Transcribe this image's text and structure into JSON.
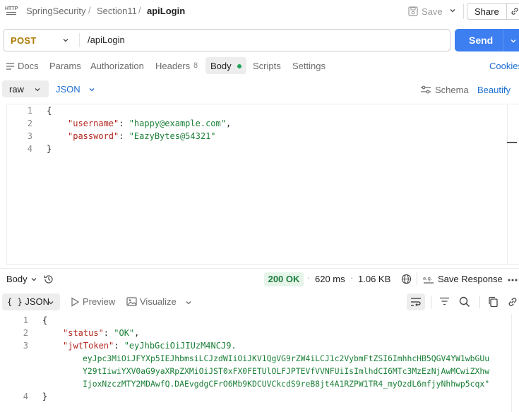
{
  "header": {
    "app_icon_text": "HTTP",
    "breadcrumbs": [
      "SpringSecurity",
      "Section11"
    ],
    "request_name": "apiLogin",
    "save_label": "Save",
    "share_label": "Share"
  },
  "request": {
    "method": "POST",
    "url": "/apiLogin",
    "send_label": "Send",
    "method_color": "#ad7a03",
    "send_color": "#3d7ff0"
  },
  "request_tabs": {
    "docs": "Docs",
    "params": "Params",
    "authorization": "Authorization",
    "headers": "Headers",
    "headers_count": "8",
    "body": "Body",
    "scripts": "Scripts",
    "settings": "Settings",
    "cookies": "Cookies"
  },
  "body_options": {
    "mode": "raw",
    "language": "JSON",
    "schema": "Schema",
    "beautify": "Beautify"
  },
  "request_body": {
    "line_numbers": [
      "1",
      "2",
      "3",
      "4"
    ],
    "open_brace": "{",
    "username_key": "\"username\"",
    "username_value": "\"happy@example.com\"",
    "password_key": "\"password\"",
    "password_value": "\"EazyBytes@54321\"",
    "close_brace": "}"
  },
  "response_bar": {
    "body_label": "Body",
    "status": "200 OK",
    "time": "620 ms",
    "size": "1.06 KB",
    "save_response": "Save Response",
    "status_color": "#1e7d3e"
  },
  "response_view": {
    "format": "JSON",
    "preview": "Preview",
    "visualize": "Visualize"
  },
  "response_body": {
    "line_numbers": [
      "1",
      "2",
      "3",
      "4"
    ],
    "open_brace": "{",
    "status_key": "\"status\"",
    "status_value": "\"OK\"",
    "token_key": "\"jwtToken\"",
    "token_lines": [
      "\"eyJhbGciOiJIUzM4NCJ9.",
      "eyJpc3MiOiJFYXp5IEJhbmsiLCJzdWIiOiJKV1QgVG9rZW4iLCJ1c2VybmFtZSI6ImhhcHB5QGV4YW1wbGUu",
      "Y29tIiwiYXV0aG9yaXRpZXMiOiJST0xFX0FETUlOLFJPTEVfVVNFUiIsImlhdCI6MTc3MzEzNjAwMCwiZXhw",
      "IjoxNzczMTY2MDAwfQ.DAEvgdgCFrO6Mb9KDCUVCkcdS9reB8jt4A1RZPW1TR4_myOzdL6mfjyNhhwp5cqx\""
    ],
    "close_brace": "}"
  }
}
